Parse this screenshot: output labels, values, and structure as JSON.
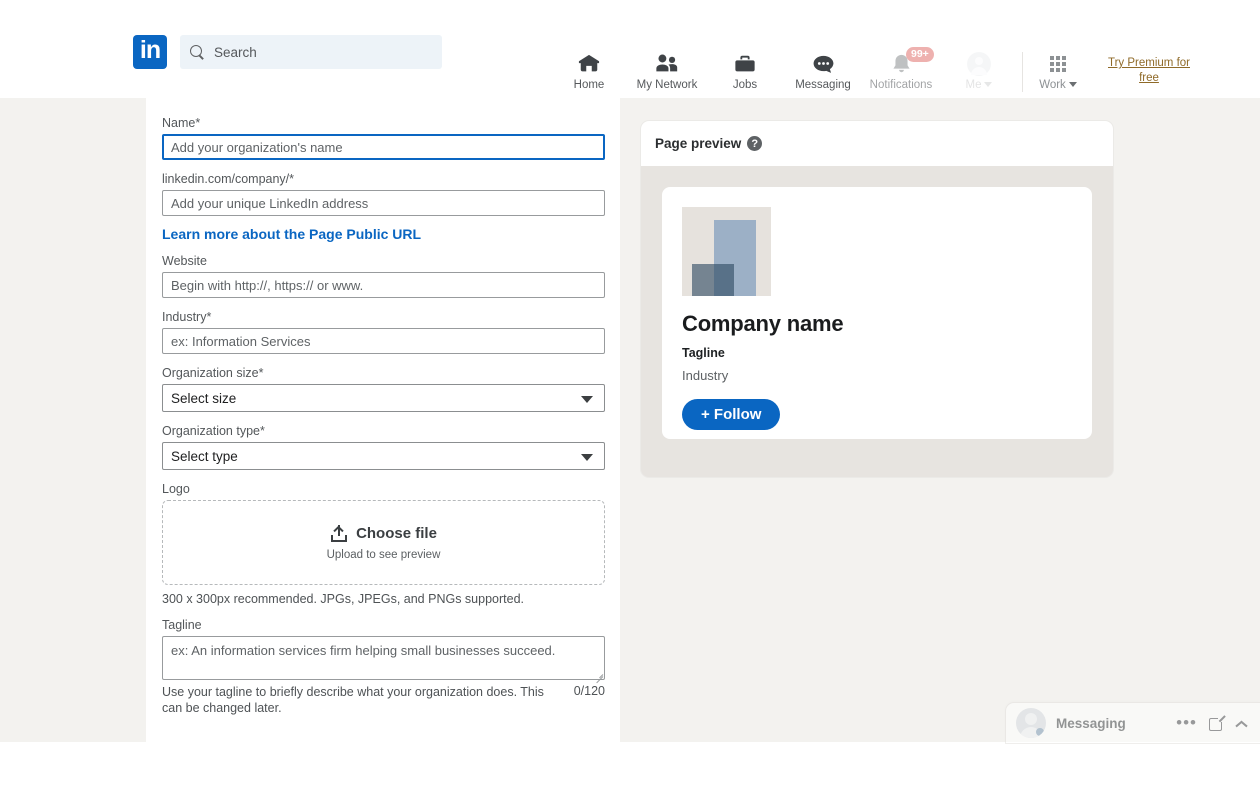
{
  "nav": {
    "logo_text": "in",
    "search_placeholder": "Search",
    "items": [
      {
        "label": "Home",
        "icon": "home-icon"
      },
      {
        "label": "My Network",
        "icon": "people-icon"
      },
      {
        "label": "Jobs",
        "icon": "briefcase-icon"
      },
      {
        "label": "Messaging",
        "icon": "chat-bubble-icon"
      },
      {
        "label": "Notifications",
        "icon": "bell-icon",
        "badge": "99+"
      },
      {
        "label": "Me",
        "icon": "avatar-icon"
      },
      {
        "label": "Work",
        "icon": "grid-icon"
      }
    ],
    "premium_link": "Try Premium for free"
  },
  "form": {
    "name": {
      "label": "Name*",
      "placeholder": "Add your organization's name",
      "value": ""
    },
    "public_url": {
      "label": "linkedin.com/company/*",
      "placeholder": "Add your unique LinkedIn address",
      "value": ""
    },
    "learn_more_link": "Learn more about the Page Public URL",
    "website": {
      "label": "Website",
      "placeholder": "Begin with http://, https:// or www.",
      "value": ""
    },
    "industry": {
      "label": "Industry*",
      "placeholder": "ex: Information Services",
      "value": ""
    },
    "org_size": {
      "label": "Organization size*",
      "value": "Select size"
    },
    "org_type": {
      "label": "Organization type*",
      "value": "Select type"
    },
    "logo": {
      "label": "Logo",
      "choose_file": "Choose file",
      "upload_hint": "Upload to see preview",
      "helper": "300 x 300px recommended. JPGs, JPEGs, and PNGs supported."
    },
    "tagline": {
      "label": "Tagline",
      "placeholder": "ex: An information services firm helping small businesses succeed.",
      "value": "",
      "helper": "Use your tagline to briefly describe what your organization does. This can be changed later.",
      "counter": "0/120"
    }
  },
  "preview": {
    "title": "Page preview",
    "help_icon_glyph": "?",
    "company_name": "Company name",
    "tagline": "Tagline",
    "industry": "Industry",
    "follow_button": "+ Follow"
  },
  "messaging": {
    "label": "Messaging",
    "more_glyph": "•••"
  },
  "colors": {
    "brand_blue": "#0a66c2",
    "page_bg": "#f3f2ef",
    "preview_bg": "#e7e4e0",
    "premium_gold": "#8f6a28",
    "badge_red": "#d9534f"
  }
}
